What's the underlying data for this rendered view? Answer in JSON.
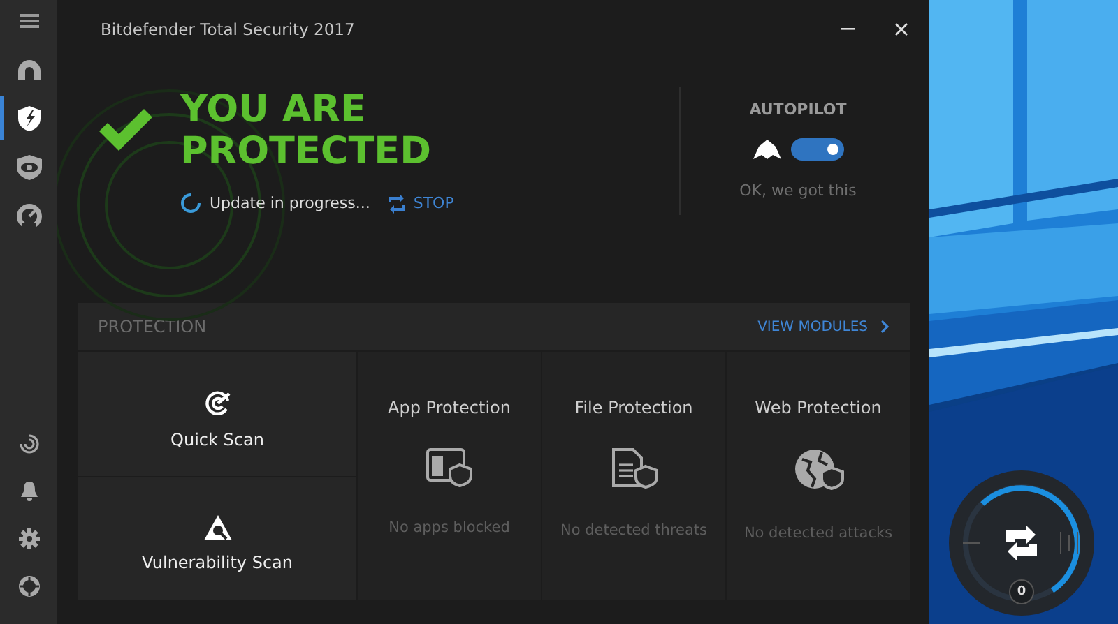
{
  "window": {
    "title": "Bitdefender Total Security 2017"
  },
  "sidebar": {
    "top_items": [
      {
        "kind": "account",
        "selected": false
      },
      {
        "kind": "shield",
        "selected": true
      },
      {
        "kind": "eye",
        "selected": false
      },
      {
        "kind": "gauge",
        "selected": false
      }
    ],
    "bottom_items": [
      {
        "kind": "spiral",
        "selected": false
      },
      {
        "kind": "bell",
        "selected": false
      },
      {
        "kind": "gear",
        "selected": false
      },
      {
        "kind": "lifebuoy",
        "selected": false
      }
    ]
  },
  "status": {
    "title_lines": [
      "YOU ARE",
      "PROTECTED"
    ],
    "update_text": "Update in progress...",
    "stop_label": "STOP"
  },
  "autopilot": {
    "label": "AUTOPILOT",
    "on": true,
    "caption": "OK, we got this"
  },
  "protection": {
    "title": "PROTECTION",
    "link": "VIEW MODULES",
    "actions": [
      {
        "kind": "quick",
        "label": "Quick Scan"
      },
      {
        "kind": "vulnerability",
        "label": "Vulnerability Scan"
      }
    ],
    "modules": [
      {
        "kind": "app",
        "title": "App Protection",
        "status": "No apps blocked"
      },
      {
        "kind": "file",
        "title": "File Protection",
        "status": "No detected threats"
      },
      {
        "kind": "web",
        "title": "Web Protection",
        "status": "No detected attacks"
      }
    ]
  },
  "widget": {
    "badge": "0"
  }
}
